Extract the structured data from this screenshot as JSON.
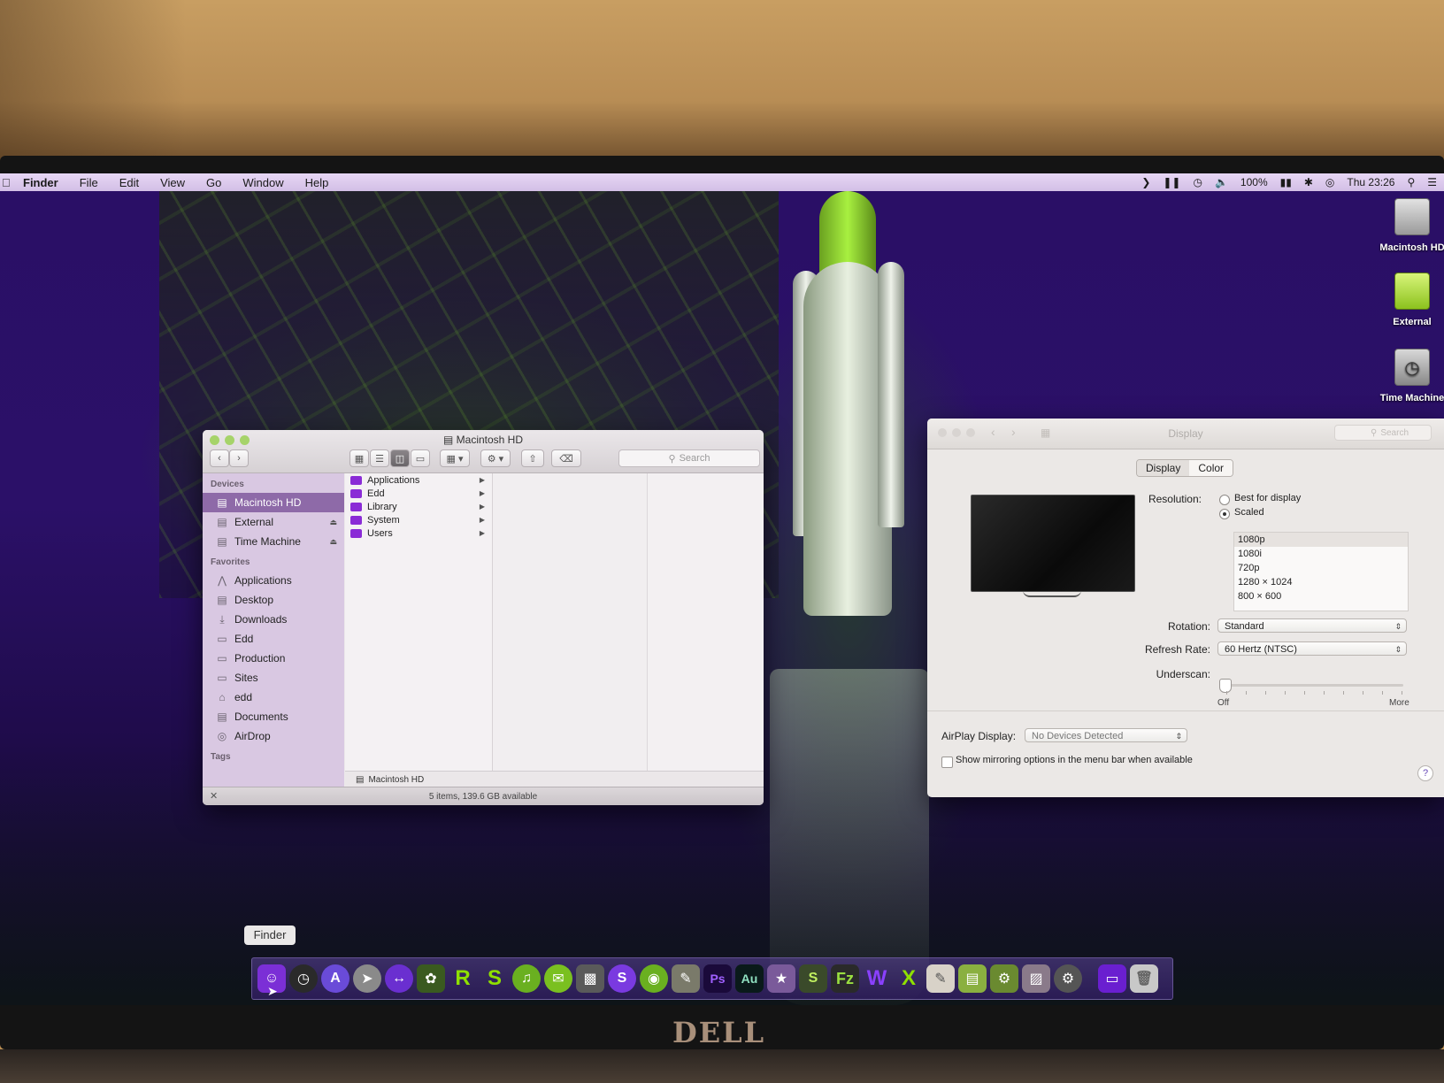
{
  "menubar": {
    "apple": "",
    "items": [
      "Finder",
      "File",
      "Edit",
      "View",
      "Go",
      "Window",
      "Help"
    ],
    "battery": "100%",
    "clock": "Thu 23:26"
  },
  "desktop_icons": [
    {
      "label": "Macintosh HD",
      "icon": "hard-drive-icon"
    },
    {
      "label": "External",
      "icon": "external-drive-icon"
    },
    {
      "label": "Time Machine",
      "icon": "time-machine-icon"
    }
  ],
  "finder": {
    "title": "Macintosh HD",
    "search_placeholder": "Search",
    "sidebar": {
      "devices_header": "Devices",
      "devices": [
        "Macintosh HD",
        "External",
        "Time Machine"
      ],
      "favorites_header": "Favorites",
      "favorites": [
        "Applications",
        "Desktop",
        "Downloads",
        "Edd",
        "Production",
        "Sites",
        "edd",
        "Documents",
        "AirDrop"
      ],
      "tags_header": "Tags"
    },
    "column_items": [
      "Applications",
      "Edd",
      "Library",
      "System",
      "Users"
    ],
    "path": "Macintosh HD",
    "status": "5 items, 139.6 GB available"
  },
  "display_prefs": {
    "title": "Display",
    "search_placeholder": "Search",
    "tabs": [
      "Display",
      "Color"
    ],
    "resolution_label": "Resolution:",
    "resolution_options": [
      "Best for display",
      "Scaled"
    ],
    "scaled_list": [
      "1080p",
      "1080i",
      "720p",
      "1280 × 1024",
      "800 × 600"
    ],
    "rotation_label": "Rotation:",
    "rotation_value": "Standard",
    "refresh_label": "Refresh Rate:",
    "refresh_value": "60 Hertz (NTSC)",
    "underscan_label": "Underscan:",
    "underscan_min": "Off",
    "underscan_max": "More",
    "airplay_label": "AirPlay Display:",
    "airplay_value": "No Devices Detected",
    "mirroring_checkbox": "Show mirroring options in the menu bar when available",
    "help": "?"
  },
  "dock": {
    "tooltip": "Finder"
  },
  "monitor_brand": "DELL"
}
